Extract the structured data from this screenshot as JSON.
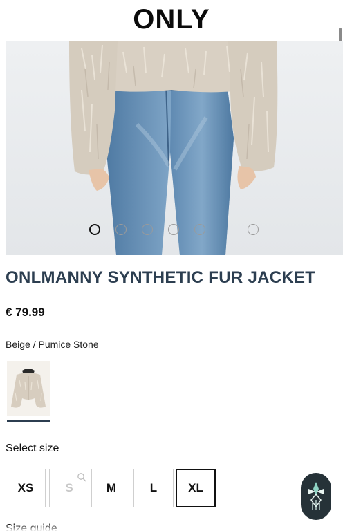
{
  "header": {
    "brand": "ONLY"
  },
  "gallery": {
    "slide_count": 6,
    "active_index": 0
  },
  "product": {
    "title": "ONLMANNY SYNTHETIC FUR JACKET",
    "price": "€ 79.99",
    "color": "Beige / Pumice Stone"
  },
  "sizes": {
    "label": "Select size",
    "options": [
      {
        "label": "XS",
        "available": true,
        "selected": false
      },
      {
        "label": "S",
        "available": false,
        "selected": false
      },
      {
        "label": "M",
        "available": true,
        "selected": false
      },
      {
        "label": "L",
        "available": true,
        "selected": false
      },
      {
        "label": "XL",
        "available": true,
        "selected": true
      }
    ],
    "guide": "Size guide"
  },
  "colors": {
    "title": "#2c3e50",
    "fur": "#d8cfc2",
    "denim": "#5b86ad",
    "fab": "#263238"
  }
}
